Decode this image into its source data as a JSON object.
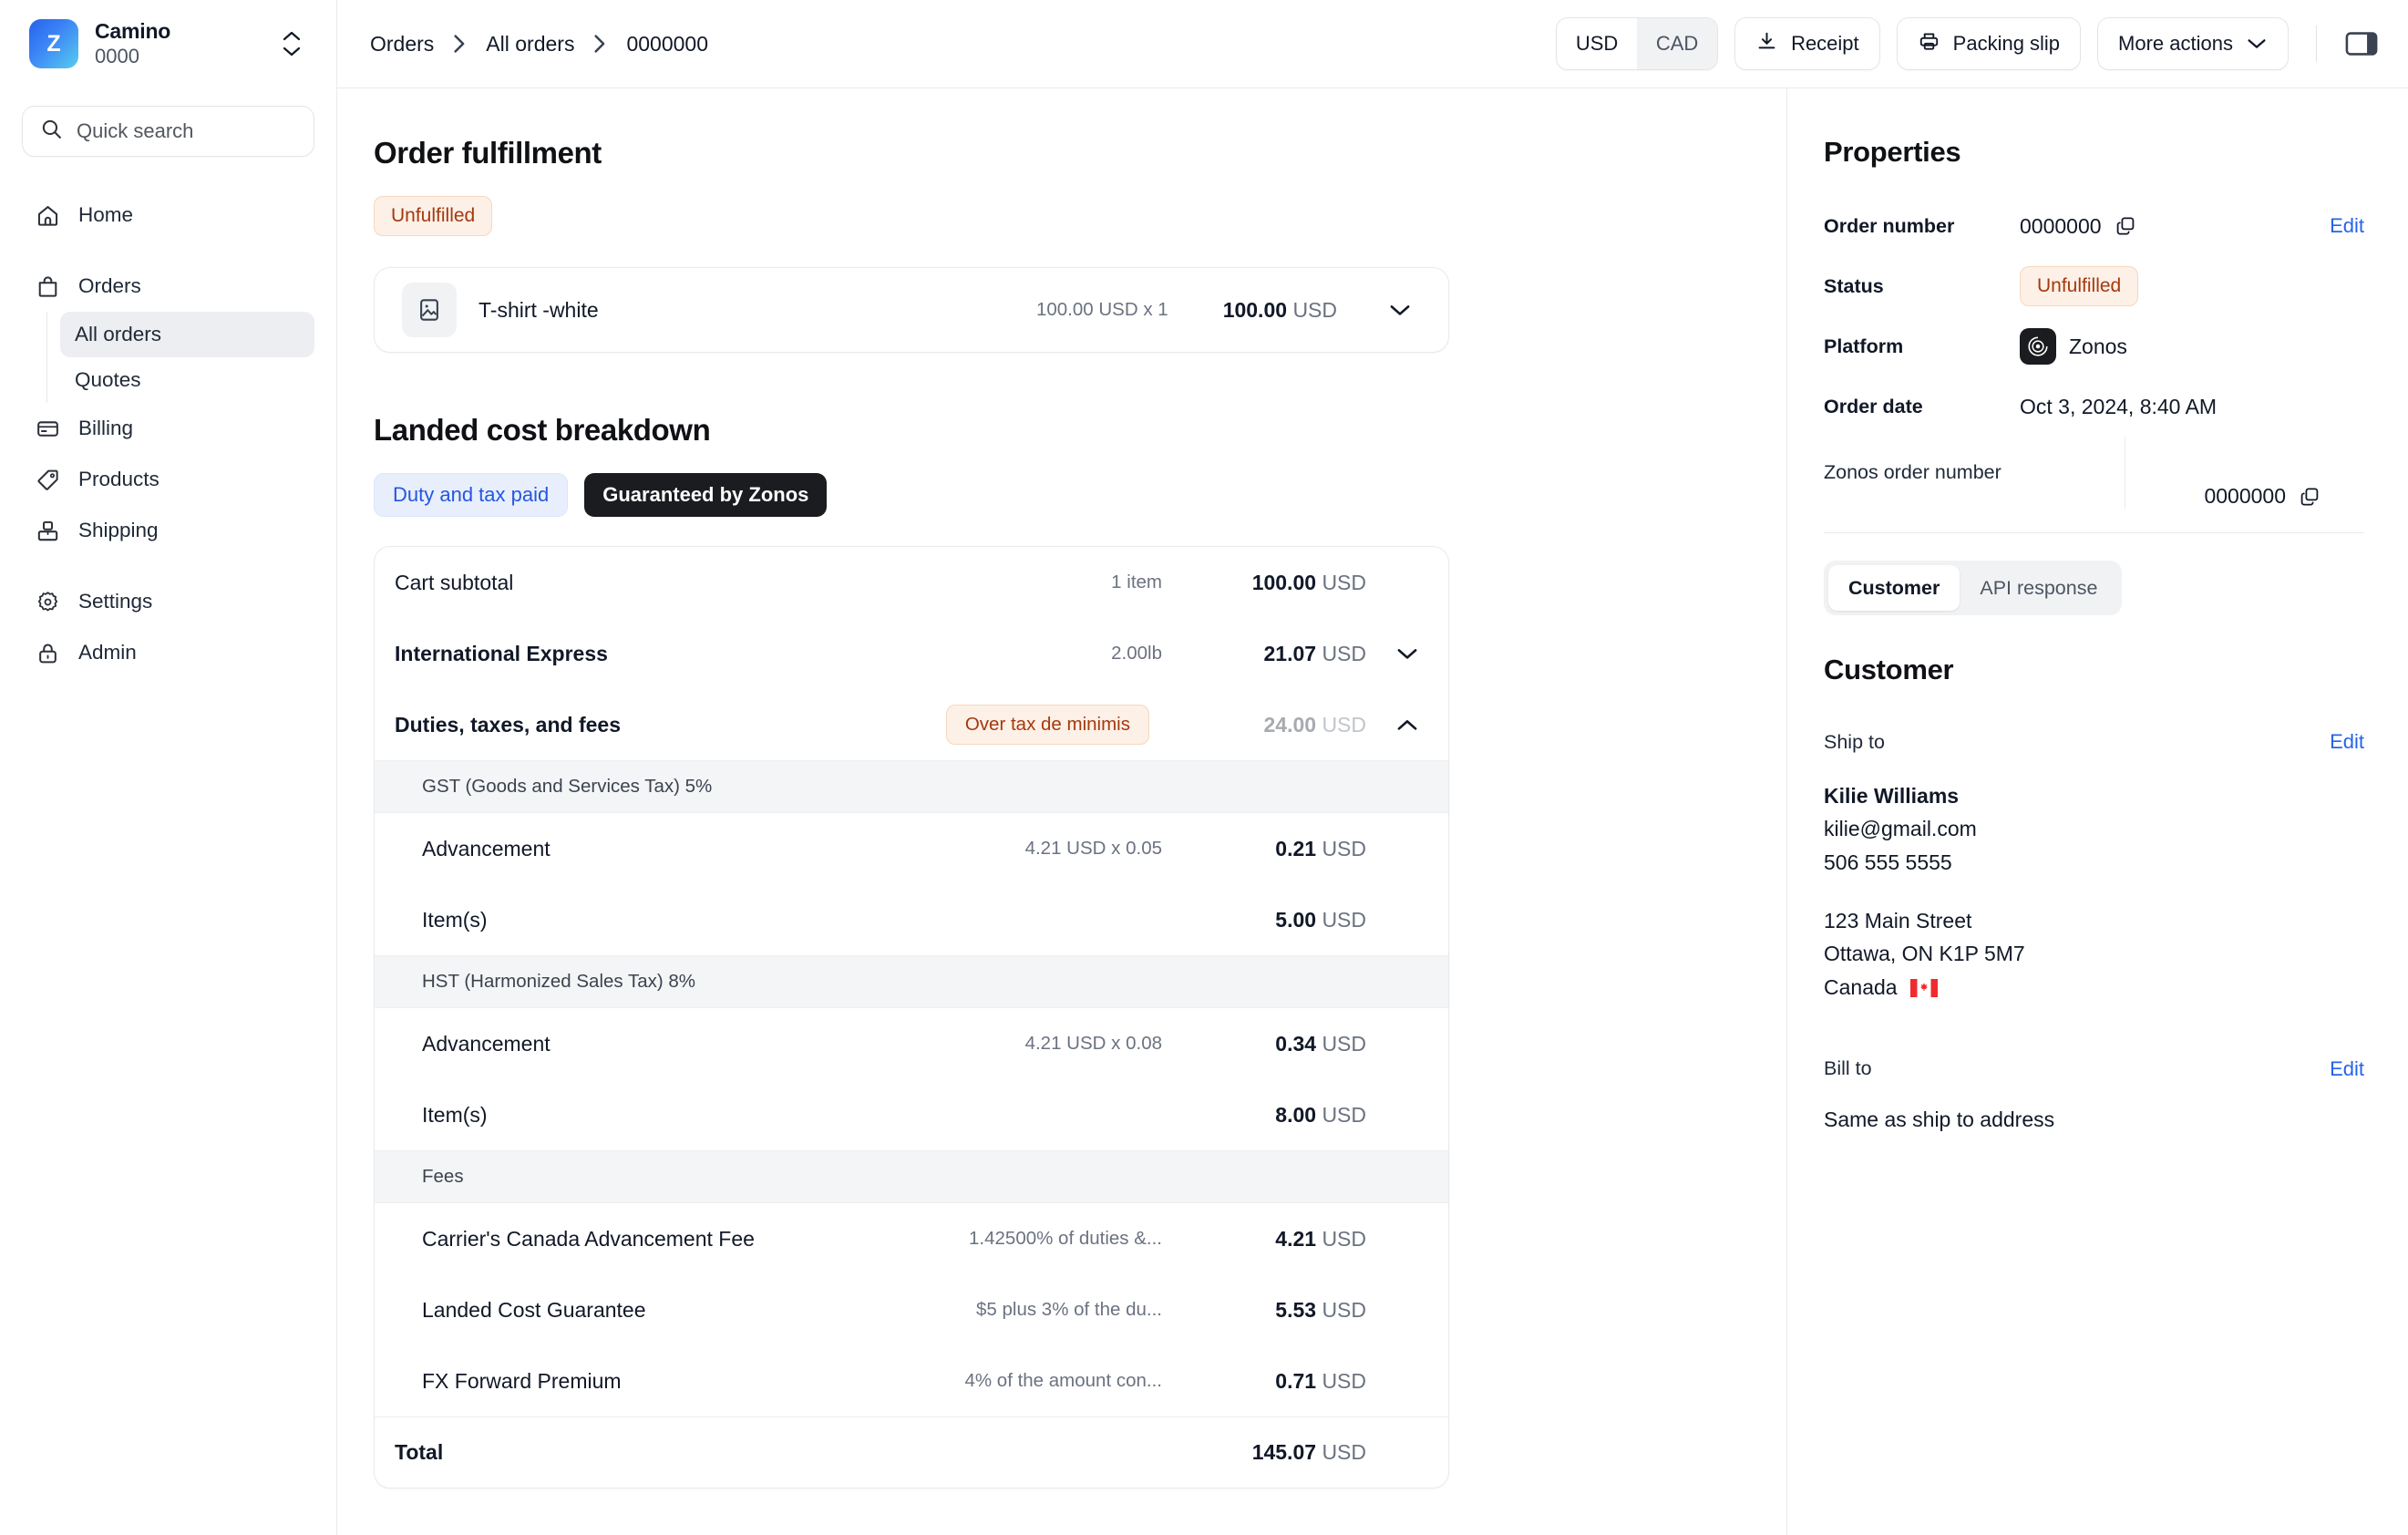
{
  "sidebar": {
    "brand": {
      "initial": "Z",
      "name": "Camino",
      "account": "0000",
      "switch_icon": "chevron-up-down-icon"
    },
    "search": {
      "placeholder": "Quick search",
      "icon": "search-icon"
    },
    "nav": [
      {
        "label": "Home",
        "icon": "home-icon"
      },
      {
        "label": "Orders",
        "icon": "shopping-bag-icon",
        "children": [
          {
            "label": "All orders",
            "active": true
          },
          {
            "label": "Quotes",
            "active": false
          }
        ]
      },
      {
        "label": "Billing",
        "icon": "credit-card-icon"
      },
      {
        "label": "Products",
        "icon": "tag-icon"
      },
      {
        "label": "Shipping",
        "icon": "package-icon"
      },
      {
        "label": "Settings",
        "icon": "gear-icon"
      },
      {
        "label": "Admin",
        "icon": "lock-icon"
      }
    ]
  },
  "topbar": {
    "breadcrumb": [
      "Orders",
      "All orders",
      "0000000"
    ],
    "currency": {
      "selected": "USD",
      "options": [
        "USD",
        "CAD"
      ]
    },
    "receipt_label": "Receipt",
    "receipt_icon": "download-icon",
    "packing_slip_label": "Packing slip",
    "packing_slip_icon": "printer-icon",
    "more_actions_label": "More actions",
    "more_actions_icon": "chevron-down-icon",
    "panel_toggle_icon": "sidebar-panel-icon"
  },
  "fulfillment": {
    "title": "Order fulfillment",
    "status_badge": "Unfulfilled",
    "items": [
      {
        "name": "T-shirt -white",
        "unit": "100.00 USD x 1",
        "amount": "100.00",
        "currency": "USD",
        "thumb_icon": "image-placeholder-icon",
        "chevron": "chevron-down-icon"
      }
    ]
  },
  "landed_cost": {
    "title": "Landed cost breakdown",
    "tags": [
      {
        "label": "Duty and tax paid",
        "style": "blue"
      },
      {
        "label": "Guaranteed by Zonos",
        "style": "dark"
      }
    ],
    "rows": [
      {
        "type": "row",
        "label": "Cart subtotal",
        "mid": "1 item",
        "amount": "100.00",
        "currency": "USD",
        "bold_label": false,
        "muted": false,
        "chevron": null
      },
      {
        "type": "row",
        "label": "International Express",
        "mid": "2.00lb",
        "amount": "21.07",
        "currency": "USD",
        "bold_label": true,
        "muted": false,
        "chevron": "chevron-down-icon"
      },
      {
        "type": "row",
        "label": "Duties, taxes, and fees",
        "badge": "Over tax de minimis",
        "amount": "24.00",
        "currency": "USD",
        "bold_label": true,
        "muted": true,
        "chevron": "chevron-up-icon"
      },
      {
        "type": "group",
        "label": "GST (Goods and Services Tax) 5%"
      },
      {
        "type": "sub",
        "label": "Advancement",
        "mid": "4.21 USD x 0.05",
        "amount": "0.21",
        "currency": "USD"
      },
      {
        "type": "sub",
        "label": "Item(s)",
        "mid": "",
        "amount": "5.00",
        "currency": "USD"
      },
      {
        "type": "group",
        "label": "HST (Harmonized Sales Tax) 8%"
      },
      {
        "type": "sub",
        "label": "Advancement",
        "mid": "4.21 USD x 0.08",
        "amount": "0.34",
        "currency": "USD"
      },
      {
        "type": "sub",
        "label": "Item(s)",
        "mid": "",
        "amount": "8.00",
        "currency": "USD"
      },
      {
        "type": "group",
        "label": "Fees"
      },
      {
        "type": "sub",
        "label": "Carrier's Canada Advancement Fee",
        "mid": "1.42500% of duties &...",
        "amount": "4.21",
        "currency": "USD"
      },
      {
        "type": "sub",
        "label": "Landed Cost Guarantee",
        "mid": "$5 plus 3% of the du...",
        "amount": "5.53",
        "currency": "USD"
      },
      {
        "type": "sub",
        "label": "FX Forward Premium",
        "mid": "4% of the amount con...",
        "amount": "0.71",
        "currency": "USD"
      },
      {
        "type": "total",
        "label": "Total",
        "amount": "145.07",
        "currency": "USD"
      }
    ]
  },
  "properties": {
    "title": "Properties",
    "order_number": {
      "label": "Order number",
      "value": "0000000",
      "copy_icon": "copy-icon",
      "edit": "Edit"
    },
    "status": {
      "label": "Status",
      "value": "Unfulfilled"
    },
    "platform": {
      "label": "Platform",
      "value": "Zonos",
      "logo_icon": "zonos-logo-icon"
    },
    "order_date": {
      "label": "Order date",
      "value": "Oct 3, 2024, 8:40 AM"
    },
    "zonos_order_number": {
      "label": "Zonos order number",
      "value": "0000000",
      "copy_icon": "copy-icon"
    }
  },
  "customer_panel": {
    "tabs": [
      {
        "label": "Customer",
        "active": true
      },
      {
        "label": "API response",
        "active": false
      }
    ],
    "heading": "Customer",
    "ship_to": {
      "label": "Ship to",
      "edit": "Edit",
      "name": "Kilie Williams",
      "email": "kilie@gmail.com",
      "phone": "506 555 5555",
      "street": "123 Main Street",
      "city_region": "Ottawa, ON K1P 5M7",
      "country": "Canada",
      "flag": "canada-flag-icon"
    },
    "bill_to": {
      "label": "Bill to",
      "edit": "Edit",
      "value": "Same as ship to address"
    }
  },
  "colors": {
    "accent_link": "#2563eb",
    "warning_bg": "#fdf0e6",
    "warning_text": "#a4390e",
    "tag_blue_bg": "#e8eefc",
    "tag_blue_text": "#2556e0",
    "tag_dark_bg": "#1b1c1f"
  }
}
